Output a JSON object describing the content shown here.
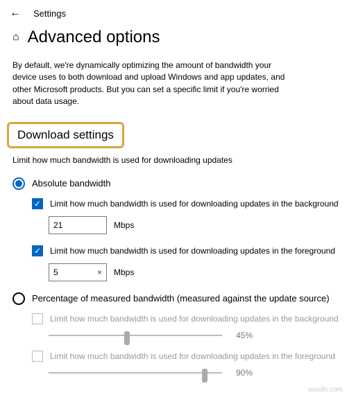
{
  "topbar": {
    "title": "Settings"
  },
  "header": {
    "title": "Advanced options"
  },
  "description": "By default, we're dynamically optimizing the amount of bandwidth your device uses to both download and upload Windows and app updates, and other Microsoft products. But you can set a specific limit if you're worried about data usage.",
  "download": {
    "section_title": "Download settings",
    "section_sub": "Limit how much bandwidth is used for downloading updates",
    "abs_label": "Absolute bandwidth",
    "pct_label": "Percentage of measured bandwidth (measured against the update source)",
    "bg_check_label": "Limit how much bandwidth is used for downloading updates in the background",
    "fg_check_label": "Limit how much bandwidth is used for downloading updates in the foreground",
    "bg_mbps": "21",
    "fg_mbps": "5",
    "unit": "Mbps",
    "bg_pct": "45%",
    "fg_pct": "90%",
    "pct_bg_check_label": "Limit how much bandwidth is used for downloading updates in the background",
    "pct_fg_check_label": "Limit how much bandwidth is used for downloading updates in the foreground",
    "clear_symbol": "×"
  },
  "watermark": "wsxdn.com"
}
